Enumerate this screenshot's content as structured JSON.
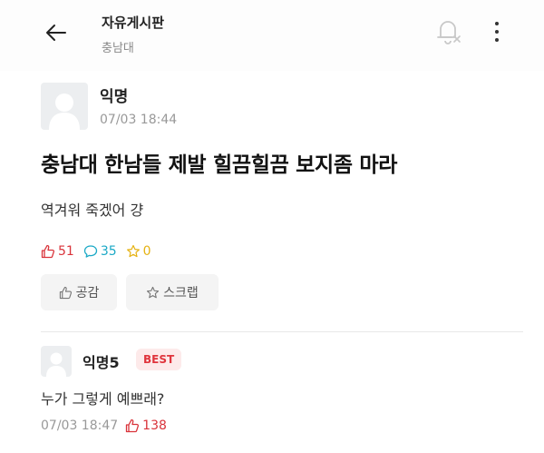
{
  "header": {
    "title": "자유게시판",
    "subtitle": "충남대",
    "back_icon": "arrow-left-icon",
    "notification_icon": "bell-off-icon",
    "more_icon": "more-vertical-icon"
  },
  "post": {
    "author": "익명",
    "time": "07/03 18:44",
    "title": "충남대 한남들 제발 힐끔힐끔 보지좀 마라",
    "body": "역겨워 죽겠어 걍",
    "likes": "51",
    "comments": "35",
    "scraps": "0",
    "like_button_label": "공감",
    "scrap_button_label": "스크랩"
  },
  "comment": {
    "author": "익명5",
    "badge": "BEST",
    "text": "누가 그렇게 예쁘래?",
    "time": "07/03 18:47",
    "likes": "138"
  },
  "colors": {
    "like": "#d9333a",
    "comment": "#1ba9c6",
    "scrap": "#e5b212",
    "best_badge_bg": "#fdeaea",
    "best_badge_text": "#e0353d"
  }
}
